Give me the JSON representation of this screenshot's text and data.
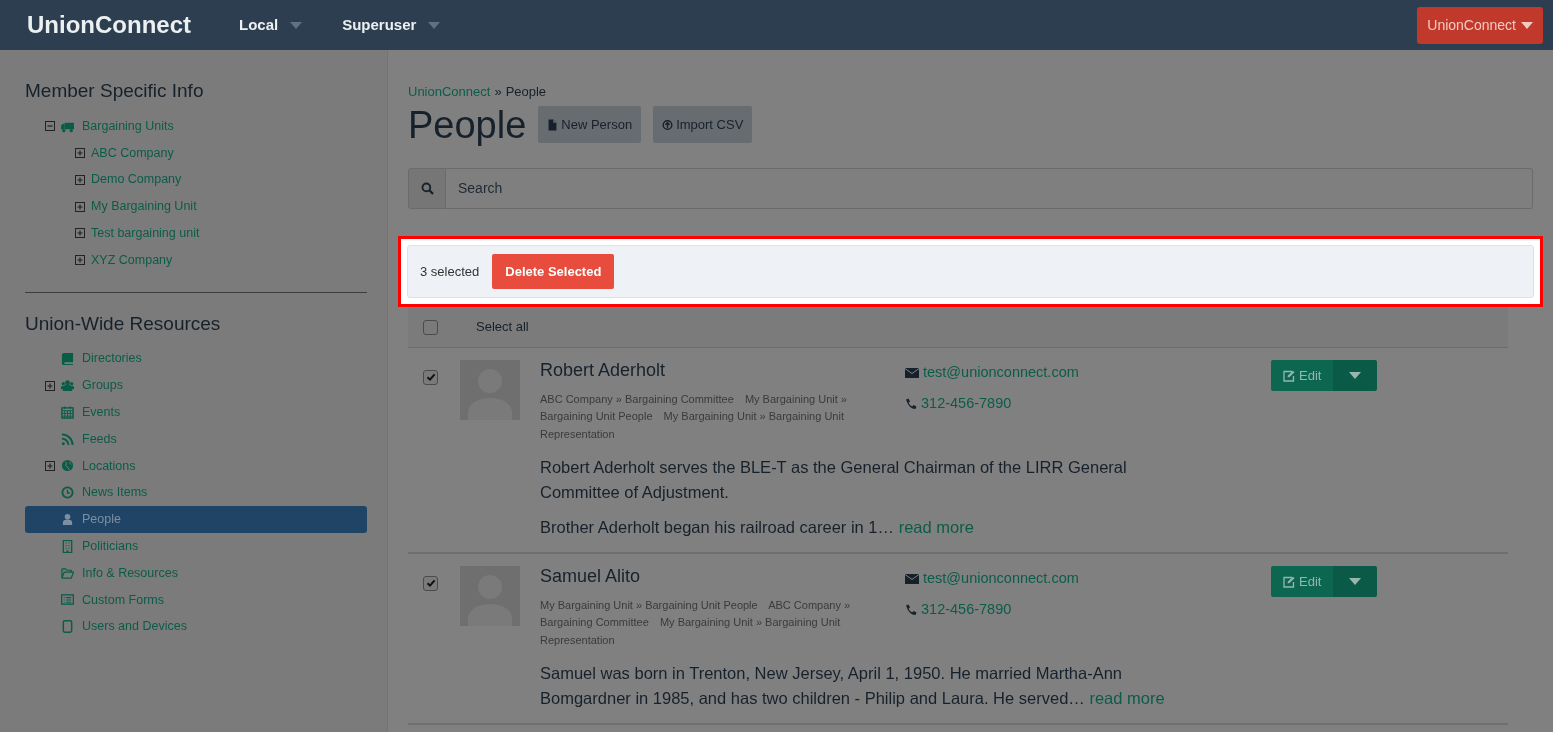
{
  "navbar": {
    "brand": "UnionConnect",
    "menus": [
      {
        "label": "Local"
      },
      {
        "label": "Superuser"
      }
    ],
    "account_button": "UnionConnect"
  },
  "sidebar": {
    "sections": [
      {
        "title": "Member Specific Info",
        "items": [
          {
            "label": "Bargaining Units",
            "kind": "branch",
            "expanded": true,
            "selected": false,
            "children": [
              {
                "label": "ABC Company",
                "kind": "branch",
                "expanded": false,
                "selected": false
              },
              {
                "label": "Demo Company",
                "kind": "branch",
                "expanded": false,
                "selected": false
              },
              {
                "label": "My Bargaining Unit",
                "kind": "branch",
                "expanded": false,
                "selected": false
              },
              {
                "label": "Test bargaining unit",
                "kind": "branch",
                "expanded": false,
                "selected": false
              },
              {
                "label": "XYZ Company",
                "kind": "branch",
                "expanded": false,
                "selected": false
              }
            ]
          }
        ]
      },
      {
        "title": "Union-Wide Resources",
        "items": [
          {
            "label": "Directories",
            "kind": "leaf",
            "selected": false
          },
          {
            "label": "Groups",
            "kind": "branch",
            "expanded": false,
            "selected": false
          },
          {
            "label": "Events",
            "kind": "leaf",
            "selected": false
          },
          {
            "label": "Feeds",
            "kind": "leaf",
            "selected": false
          },
          {
            "label": "Locations",
            "kind": "branch",
            "expanded": false,
            "selected": false
          },
          {
            "label": "News Items",
            "kind": "leaf",
            "selected": false
          },
          {
            "label": "People",
            "kind": "leaf",
            "selected": true
          },
          {
            "label": "Politicians",
            "kind": "leaf",
            "selected": false
          },
          {
            "label": "Info & Resources",
            "kind": "leaf",
            "selected": false
          },
          {
            "label": "Custom Forms",
            "kind": "leaf",
            "selected": false
          },
          {
            "label": "Users and Devices",
            "kind": "leaf",
            "selected": false
          }
        ]
      }
    ]
  },
  "breadcrumb": {
    "items": [
      "UnionConnect",
      "People"
    ],
    "separator": "»"
  },
  "page_title": "People",
  "header_buttons": [
    "New Person",
    "Import CSV"
  ],
  "search": {
    "placeholder": "Search"
  },
  "selection_bar": {
    "count": "3 selected",
    "button": "Delete Selected",
    "highlighted": true
  },
  "select_all": {
    "label": "Select all",
    "checked": false
  },
  "people": [
    {
      "name": "Robert Aderholt",
      "checked": true,
      "tags": [
        "ABC Company » Bargaining Committee",
        "My Bargaining Unit » Bargaining Unit People",
        "My Bargaining Unit » Bargaining Unit Representation"
      ],
      "bio": [
        "Robert Aderholt serves the BLE-T as the General Chairman of the LIRR General Committee of Adjustment.",
        "Brother Aderholt began his railroad career in 1…"
      ],
      "read_more": "read more",
      "email": "test@unionconnect.com",
      "phone": "312-456-7890",
      "edit": "Edit"
    },
    {
      "name": "Samuel Alito",
      "checked": true,
      "tags": [
        "My Bargaining Unit » Bargaining Unit People",
        "ABC Company » Bargaining Committee",
        "My Bargaining Unit » Bargaining Unit Representation"
      ],
      "bio": [
        "Samuel was born in Trenton, New Jersey, April 1, 1950. He married Martha-Ann Bomgardner in 1985, and has two children - Philip and Laura. He served…"
      ],
      "read_more": "read more",
      "email": "test@unionconnect.com",
      "phone": "312-456-7890",
      "edit": "Edit"
    }
  ]
}
